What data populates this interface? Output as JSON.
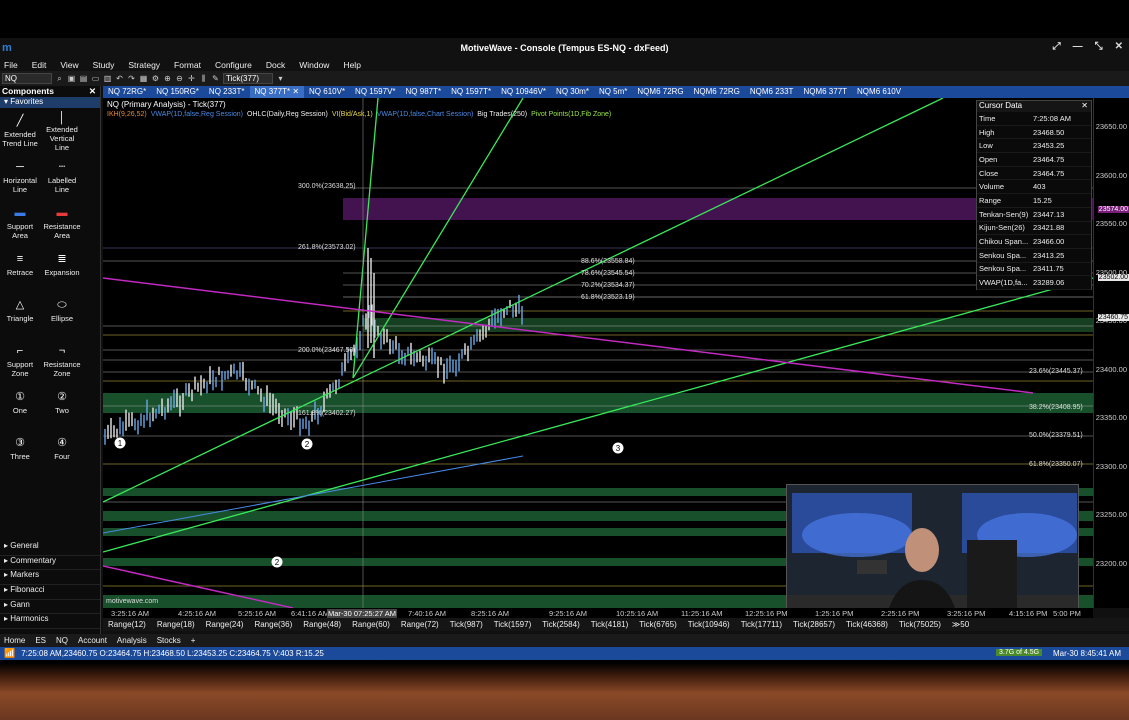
{
  "app": {
    "title": "MotiveWave - Console (Tempus ES-NQ - dxFeed)",
    "logo": "m"
  },
  "menu": [
    "File",
    "Edit",
    "View",
    "Study",
    "Strategy",
    "Format",
    "Configure",
    "Dock",
    "Window",
    "Help"
  ],
  "toolbar": {
    "symbol": "NQ",
    "timeframe": "Tick(377)"
  },
  "sidebar": {
    "title": "Components",
    "favorites": "Favorites",
    "tools": [
      {
        "label": "Extended Trend Line",
        "icon": "trend-line-icon"
      },
      {
        "label": "Extended Vertical Line",
        "icon": "vertical-line-icon"
      },
      {
        "label": "Horizontal Line",
        "icon": "horizontal-line-icon"
      },
      {
        "label": "Labelled Line",
        "icon": "labelled-line-icon"
      },
      {
        "label": "Support Area",
        "icon": "support-area-icon"
      },
      {
        "label": "Resistance Area",
        "icon": "resistance-area-icon"
      },
      {
        "label": "Retrace",
        "icon": "retrace-icon"
      },
      {
        "label": "Expansion",
        "icon": "expansion-icon"
      },
      {
        "label": "Triangle",
        "icon": "triangle-icon"
      },
      {
        "label": "Ellipse",
        "icon": "ellipse-icon"
      },
      {
        "label": "Support Zone",
        "icon": "support-zone-icon"
      },
      {
        "label": "Resistance Zone",
        "icon": "resistance-zone-icon"
      },
      {
        "label": "One",
        "icon": "1"
      },
      {
        "label": "Two",
        "icon": "2"
      },
      {
        "label": "Three",
        "icon": "3"
      },
      {
        "label": "Four",
        "icon": "4"
      }
    ],
    "categories": [
      "General",
      "Commentary",
      "Markers",
      "Fibonacci",
      "Gann",
      "Harmonics"
    ]
  },
  "tabs": [
    "NQ 72RG*",
    "NQ 150RG*",
    "NQ 233T*",
    "NQ 377T*",
    "NQ 610V*",
    "NQ 1597V*",
    "NQ 987T*",
    "NQ 1597T*",
    "NQ 10946V*",
    "NQ 30m*",
    "NQ 5m*",
    "NQM6 72RG",
    "NQM6 72RG",
    "NQM6 233T",
    "NQM6 377T",
    "NQM6 610V"
  ],
  "active_tab": "NQ 377T*",
  "chart": {
    "title": "NQ (Primary Analysis) - Tick(377)",
    "indicators": [
      {
        "text": "IKH(9,26,52)",
        "color": "#e88a3a"
      },
      {
        "text": "VWAP(1D,false,Reg Session)",
        "color": "#4a8ae8"
      },
      {
        "text": "OHLC(Daily,Reg Session)",
        "color": "#eeeeee"
      },
      {
        "text": "VI(Bid/Ask,1)",
        "color": "#e8d84a"
      },
      {
        "text": "VWAP(1D,false,Chart Session)",
        "color": "#4a8ae8"
      },
      {
        "text": "Big Trades(250)",
        "color": "#eeeeee"
      },
      {
        "text": "Pivot Points(1D,Fib Zone)",
        "color": "#9ae84a"
      }
    ],
    "fib_labels": [
      "300.0%(23638.25)",
      "261.8%(23573.02)",
      "88.6%(23558.84)",
      "78.6%(23545.54)",
      "70.2%(23534.37)",
      "61.8%(23523.19)",
      "200.0%(23467.50)",
      "23.6%(23445.37)",
      "161.8%(23402.27)",
      "38.2%(23408.95)",
      "50.0%(23379.51)",
      "61.8%(23350.07)"
    ],
    "wave_labels": [
      "1",
      "2",
      "3",
      "2",
      "2",
      "1"
    ],
    "watermark": "motivewave.com"
  },
  "cursor_data": {
    "title": "Cursor Data",
    "rows": [
      {
        "k": "Time",
        "v": "7:25:08 AM"
      },
      {
        "k": "High",
        "v": "23468.50"
      },
      {
        "k": "Low",
        "v": "23453.25"
      },
      {
        "k": "Open",
        "v": "23464.75"
      },
      {
        "k": "Close",
        "v": "23464.75"
      },
      {
        "k": "Volume",
        "v": "403"
      },
      {
        "k": "Range",
        "v": "15.25"
      },
      {
        "k": "Tenkan-Sen(9)",
        "v": "23447.13"
      },
      {
        "k": "Kijun-Sen(26)",
        "v": "23421.88"
      },
      {
        "k": "Chikou Span...",
        "v": "23466.00"
      },
      {
        "k": "Senkou Spa...",
        "v": "23413.25"
      },
      {
        "k": "Senkou Spa...",
        "v": "23411.75"
      },
      {
        "k": "VWAP(1D,fa...",
        "v": "23289.06"
      }
    ]
  },
  "price_axis": [
    "23650.00",
    "23600.00",
    "23550.00",
    "23500.00",
    "23450.00",
    "23400.00",
    "23350.00",
    "23300.00",
    "23250.00",
    "23200.00"
  ],
  "price_highlights": [
    {
      "text": "23574.00",
      "style": "purple"
    },
    {
      "text": "23502.00",
      "style": "white"
    },
    {
      "text": "23460.75",
      "style": "white"
    }
  ],
  "time_axis": [
    "3:25:16 AM",
    "4:25:16 AM",
    "5:25:16 AM",
    "6:41:16 AM",
    "Mar-30 07:25:27 AM",
    "7:40:16 AM",
    "8:25:16 AM",
    "9:25:16 AM",
    "10:25:16 AM",
    "11:25:16 AM",
    "12:25:16 PM",
    "1:25:16 PM",
    "2:25:16 PM",
    "3:25:16 PM",
    "4:15:16 PM",
    "5:00 PM"
  ],
  "ranges": [
    "Range(12)",
    "Range(18)",
    "Range(24)",
    "Range(36)",
    "Range(48)",
    "Range(60)",
    "Range(72)",
    "Tick(987)",
    "Tick(1597)",
    "Tick(2584)",
    "Tick(4181)",
    "Tick(6765)",
    "Tick(10946)",
    "Tick(17711)",
    "Tick(28657)",
    "Tick(46368)",
    "Tick(75025)",
    "≫50"
  ],
  "bottom_tabs": [
    "Home",
    "ES",
    "NQ",
    "Account",
    "Analysis",
    "Stocks",
    "+"
  ],
  "status": {
    "text": "7:25:08 AM,23460.75 O:23464.75 H:23468.50 L:23453.25 C:23464.75 V:403 R:15.25",
    "badge": "3.7G of 4.5G",
    "time": "Mar-30 8:45:41 AM"
  },
  "colors": {
    "tab_blue": "#1c4a9a",
    "fib_green": "#1f6b3a",
    "trend_green": "#3ae85a",
    "magenta": "#c02ac0",
    "purple_zone": "#5a1a6a"
  }
}
